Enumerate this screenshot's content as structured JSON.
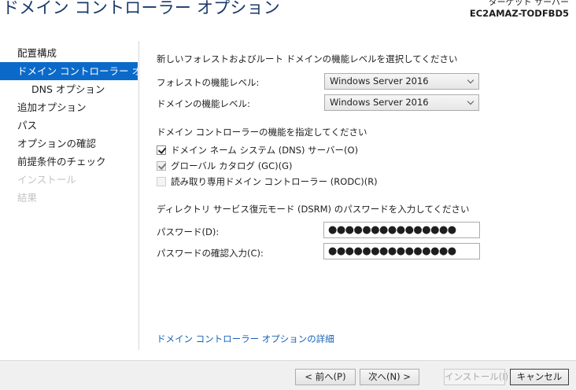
{
  "window": {
    "title": "ドメイン コントローラー オプション",
    "target_label": "ターゲット サーバー",
    "target_server": "EC2AMAZ-TODFBD5"
  },
  "nav": {
    "items": [
      {
        "label": "配置構成",
        "state": "normal"
      },
      {
        "label": "ドメイン コントローラー オプション",
        "state": "active"
      },
      {
        "label": "DNS オプション",
        "state": "sub"
      },
      {
        "label": "追加オプション",
        "state": "normal"
      },
      {
        "label": "パス",
        "state": "normal"
      },
      {
        "label": "オプションの確認",
        "state": "normal"
      },
      {
        "label": "前提条件のチェック",
        "state": "normal"
      },
      {
        "label": "インストール",
        "state": "disabled"
      },
      {
        "label": "結果",
        "state": "disabled"
      }
    ]
  },
  "functional": {
    "heading": "新しいフォレストおよびルート ドメインの機能レベルを選択してください",
    "forest_label": "フォレストの機能レベル:",
    "forest_value": "Windows Server 2016",
    "domain_label": "ドメインの機能レベル:",
    "domain_value": "Windows Server 2016"
  },
  "capabilities": {
    "heading": "ドメイン コントローラーの機能を指定してください",
    "dns_label": "ドメイン ネーム システム (DNS) サーバー(O)",
    "gc_label": "グローバル カタログ (GC)(G)",
    "rodc_label": "読み取り専用ドメイン コントローラー (RODC)(R)",
    "dns_checked": true,
    "gc_checked": true,
    "rodc_checked": false
  },
  "dsrm": {
    "heading": "ディレクトリ サービス復元モード (DSRM) のパスワードを入力してください",
    "password_label": "パスワード(D):",
    "password_value": "●●●●●●●●●●●●●●●",
    "confirm_label": "パスワードの確認入力(C):",
    "confirm_value": "●●●●●●●●●●●●●●●"
  },
  "more_link": "ドメイン コントローラー オプションの詳細",
  "buttons": {
    "back": "< 前へ(P)",
    "next": "次へ(N) >",
    "install": "インストール(I)",
    "cancel": "キャンセル"
  }
}
